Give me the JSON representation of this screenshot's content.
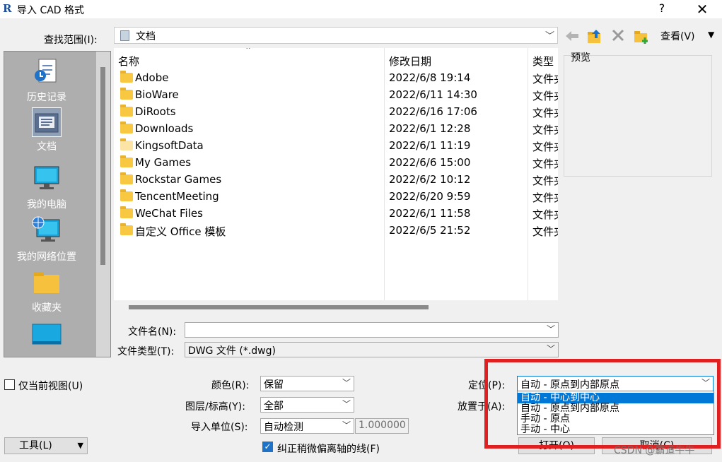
{
  "window": {
    "title": "导入 CAD 格式",
    "help": "?",
    "close": "✕"
  },
  "lookin": {
    "label": "查找范围(I):",
    "value": "文档"
  },
  "toolbar": {
    "view_label": "查看(V)",
    "icons": [
      "back-arrow-icon",
      "up-folder-icon",
      "delete-icon",
      "new-folder-icon",
      "chevron-down-icon"
    ]
  },
  "places": [
    {
      "label": "历史记录",
      "icon": "history-icon"
    },
    {
      "label": "文档",
      "icon": "documents-icon"
    },
    {
      "label": "我的电脑",
      "icon": "computer-icon"
    },
    {
      "label": "我的网络位置",
      "icon": "network-icon"
    },
    {
      "label": "收藏夹",
      "icon": "favorites-icon"
    }
  ],
  "filelist": {
    "columns": [
      "名称",
      "修改日期",
      "类型"
    ],
    "rows": [
      {
        "name": "Adobe",
        "date": "2022/6/8 19:14",
        "type": "文件夹"
      },
      {
        "name": "BioWare",
        "date": "2022/6/11 14:30",
        "type": "文件夹"
      },
      {
        "name": "DiRoots",
        "date": "2022/6/16 17:06",
        "type": "文件夹"
      },
      {
        "name": "Downloads",
        "date": "2022/6/1 12:28",
        "type": "文件夹"
      },
      {
        "name": "KingsoftData",
        "date": "2022/6/1 11:19",
        "type": "文件夹"
      },
      {
        "name": "My Games",
        "date": "2022/6/6 15:00",
        "type": "文件夹"
      },
      {
        "name": "Rockstar Games",
        "date": "2022/6/2 10:12",
        "type": "文件夹"
      },
      {
        "name": "TencentMeeting",
        "date": "2022/6/20 9:59",
        "type": "文件夹"
      },
      {
        "name": "WeChat Files",
        "date": "2022/6/1 11:58",
        "type": "文件夹"
      },
      {
        "name": "自定义 Office 模板",
        "date": "2022/6/5 21:52",
        "type": "文件夹"
      }
    ]
  },
  "preview": {
    "label": "预览"
  },
  "filename": {
    "label": "文件名(N):",
    "value": ""
  },
  "filetype": {
    "label": "文件类型(T):",
    "value": "DWG 文件 (*.dwg)"
  },
  "options": {
    "current_view_only": "仅当前视图(U)",
    "color_label": "颜色(R):",
    "color_value": "保留",
    "layers_label": "图层/标高(Y):",
    "layers_value": "全部",
    "units_label": "导入单位(S):",
    "units_value": "自动检测",
    "units_factor": "1.000000",
    "correct_lines": "纠正稍微偏离轴的线(F)",
    "positioning_label": "定位(P):",
    "positioning_value": "自动 - 原点到内部原点",
    "placeat_label": "放置于(A):"
  },
  "positioning_options": [
    "自动 - 中心到中心",
    "自动 - 原点到内部原点",
    "手动 - 原点",
    "手动 - 中心"
  ],
  "buttons": {
    "tools": "工具(L)",
    "open": "打开(O)",
    "cancel": "取消(C)"
  },
  "watermark": "CSDN @霸道牛牛",
  "colors": {
    "highlight": "#0078d7",
    "annotation_red": "#e02020",
    "places_bg": "#aeaeae"
  }
}
